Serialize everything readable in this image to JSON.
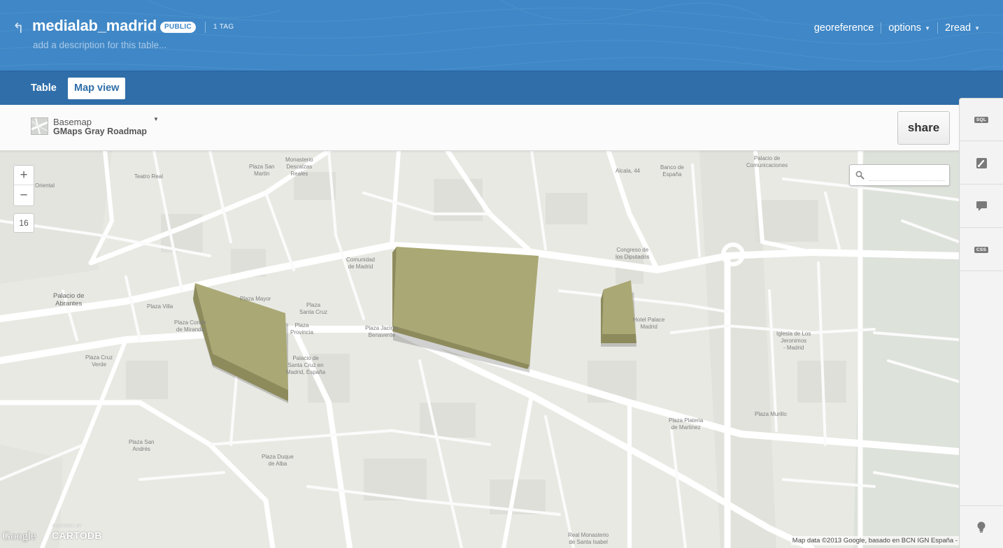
{
  "header": {
    "title": "medialab_madrid",
    "badge": "PUBLIC",
    "tag_count": "1 TAG",
    "description_placeholder": "add a description for this table...",
    "links": {
      "georeference": "georeference",
      "options": "options",
      "user": "2read"
    }
  },
  "tabs": {
    "table": "Table",
    "map_view": "Map view",
    "active": "Map view"
  },
  "toolbar": {
    "basemap_label": "Basemap",
    "basemap_value": "GMaps Gray Roadmap",
    "share_label": "share"
  },
  "map": {
    "zoom_in": "+",
    "zoom_out": "−",
    "zoom_level": "16",
    "search_placeholder": "",
    "polygon_fill": "#aaa874",
    "polygon_side": "#8d8b5c",
    "labels": {
      "plaza_san_martin": "Plaza San\nMartin",
      "monasterio": "Monasterio\nDescalzas\nReales",
      "teatro_real": "Teatro Real",
      "oriental": "Oriental",
      "palacio_abrantes": "Palacio de\nAbrantes",
      "plaza_villa": "Plaza Villa",
      "plaza_mayor": "Plaza Mayor",
      "plaza_conde_miranda": "Plaza Conde\nde Miranda",
      "plaza_cruz_verde": "Plaza Cruz\nVerde",
      "comunidad_madrid": "Comunidad\nde Madrid",
      "plaza_santa_cruz": "Plaza\nSanta Cruz",
      "plaza_provincia": "Plaza\nProvincia",
      "palacio_santa_cruz": "Palacio de\nSanta Cruz en\nMadrid, España",
      "plaza_jacinto_benavente": "Plaza Jacinto\nBenavente",
      "alcala44": "Alcala, 44",
      "banco_espana": "Banco de\nEspaña",
      "palacio_comunicaciones": "Palacio de\nComunicaciones",
      "congreso": "Congreso de\nlos Diputados",
      "hotel_palace": "Hotel Palace\nMadrid",
      "iglesia_jeronimos": "Iglesia de Los\nJeronimos\n- Madrid",
      "plaza_murillo": "Plaza Murillo",
      "plaza_plateria": "Plaza Plateria\nde Martinez",
      "plaza_san_andres": "Plaza San\nAndrés",
      "plaza_duque_alba": "Plaza Duque\nde Alba",
      "real_monasterio": "Real Monasterio\nde Santa Isabel"
    },
    "google_logo": "Google",
    "powered_by": "POWERED BY",
    "cartodb": "CARTODB",
    "attribution": "Map data ©2013 Google, basado en BCN IGN España -"
  },
  "right_panel": {
    "sql": "SQL",
    "css": "CSS",
    "icons": [
      "sql-icon",
      "paintbrush-icon",
      "comment-icon",
      "css-icon",
      "lightbulb-icon"
    ]
  }
}
